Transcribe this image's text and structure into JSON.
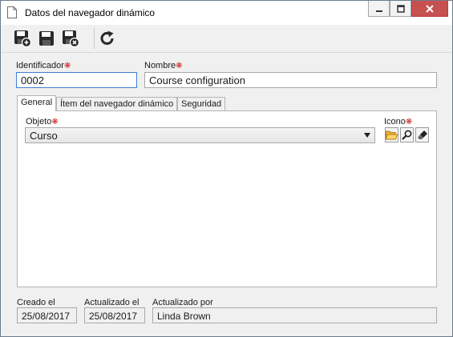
{
  "window": {
    "title": "Datos del navegador dinámico"
  },
  "form": {
    "identificador": {
      "label": "Identificador",
      "value": "0002"
    },
    "nombre": {
      "label": "Nombre",
      "value": "Course configuration"
    }
  },
  "tabs": [
    {
      "label": "General",
      "active": true
    },
    {
      "label": "Ítem del navegador dinámico",
      "active": false
    },
    {
      "label": "Seguridad",
      "active": false
    }
  ],
  "general": {
    "objeto": {
      "label": "Objeto",
      "value": "Curso"
    },
    "icono": {
      "label": "Icono"
    }
  },
  "footer": {
    "creado": {
      "label": "Creado el",
      "value": "25/08/2017"
    },
    "actualizado": {
      "label": "Actualizado el",
      "value": "25/08/2017"
    },
    "actualizado_por": {
      "label": "Actualizado por",
      "value": "Linda Brown"
    }
  },
  "required_marker": "❋",
  "colors": {
    "required": "#d21e1e",
    "close_button": "#c75050",
    "focus_border": "#3f7fd6"
  }
}
